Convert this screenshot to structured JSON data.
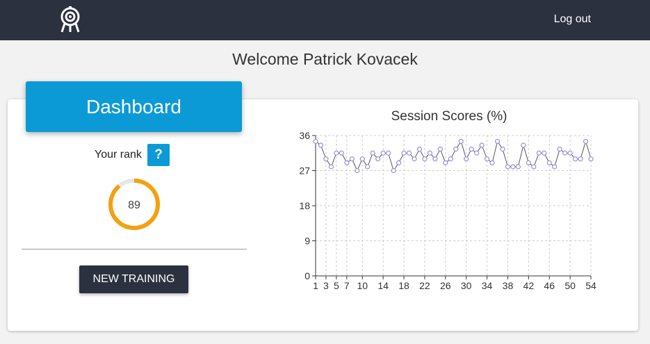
{
  "header": {
    "logout_label": "Log out",
    "logo_icon": "target-icon"
  },
  "welcome_text": "Welcome Patrick Kovacek",
  "dashboard": {
    "title": "Dashboard",
    "rank_label": "Your rank",
    "help_label": "?",
    "rank_value": "89",
    "rank_fraction": 0.89,
    "new_training_label": "NEW TRAINING"
  },
  "colors": {
    "accent": "#0c9ad7",
    "navbar": "#2c3140",
    "gauge": "#f5a00f",
    "line": "#9b8fd6"
  },
  "chart_data": {
    "type": "line",
    "title": "Session Scores (%)",
    "xlabel": "",
    "ylabel": "",
    "ylim": [
      0,
      36
    ],
    "xlim": [
      1,
      54
    ],
    "yticks": [
      "0",
      "9",
      "18",
      "27",
      "36"
    ],
    "xticks": [
      "1",
      "3",
      "5",
      "7",
      "10",
      "14",
      "18",
      "22",
      "26",
      "30",
      "34",
      "38",
      "42",
      "46",
      "50",
      "54"
    ],
    "grid": true,
    "series": [
      {
        "x": [
          1,
          2,
          3,
          4,
          5,
          6,
          7,
          8,
          9,
          10,
          11,
          12,
          13,
          14,
          15,
          16,
          17,
          18,
          19,
          20,
          21,
          22,
          23,
          24,
          25,
          26,
          27,
          28,
          29,
          30,
          31,
          32,
          33,
          34,
          35,
          36,
          37,
          38,
          39,
          40,
          41,
          42,
          43,
          44,
          45,
          46,
          47,
          48,
          49,
          50,
          51,
          52,
          53,
          54
        ],
        "values": [
          34.5,
          33.5,
          30,
          28,
          31.5,
          31.5,
          29,
          30,
          27,
          30,
          28,
          31.5,
          30,
          31.5,
          31.5,
          27,
          29,
          31.5,
          31.5,
          30,
          32.5,
          30,
          31.5,
          30,
          32.5,
          29,
          30,
          32.5,
          34.5,
          30,
          32.5,
          31.5,
          33.5,
          30,
          29,
          34.5,
          32.5,
          28,
          28,
          28,
          33.5,
          29,
          28,
          31.5,
          31.5,
          29,
          28,
          32.5,
          31.5,
          31.5,
          30,
          30,
          34.5,
          30
        ]
      }
    ]
  }
}
